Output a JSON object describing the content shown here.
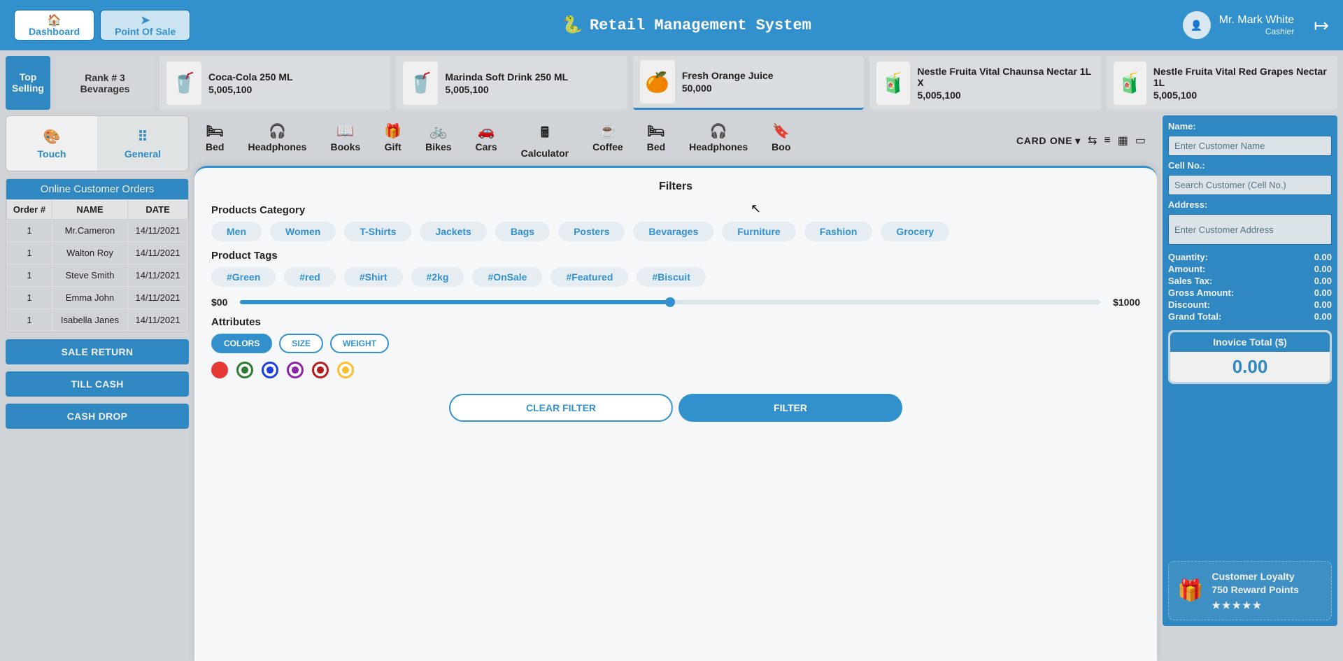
{
  "header": {
    "nav": [
      {
        "label": "Dashboard",
        "icon": "🏠"
      },
      {
        "label": "Point Of Sale",
        "icon": "➤"
      }
    ],
    "title": "Retail Management System",
    "title_icon": "🐍",
    "user": {
      "name": "Mr. Mark White",
      "role": "Cashier",
      "avatar": "👤",
      "logout_icon": "↦"
    }
  },
  "topselling": {
    "label": "Top Selling",
    "rank": {
      "line1": "Rank # 3",
      "line2": "Bevarages"
    },
    "products": [
      {
        "name": "Coca-Cola 250 ML",
        "price": "5,005,100",
        "icon": "🥤",
        "color": "#c62828",
        "hl": false
      },
      {
        "name": "Marinda Soft Drink 250 ML",
        "price": "5,005,100",
        "icon": "🥤",
        "color": "#f57c00",
        "hl": false
      },
      {
        "name": "Fresh Orange Juice",
        "price": "50,000",
        "icon": "🍊",
        "color": "#fb8c00",
        "hl": true
      },
      {
        "name": "Nestle Fruita Vital Chaunsa Nectar 1L X",
        "price": "5,005,100",
        "icon": "🧃",
        "color": "#ffa000",
        "hl": false
      },
      {
        "name": "Nestle Fruita Vital Red Grapes Nectar 1L",
        "price": "5,005,100",
        "icon": "🧃",
        "color": "#c62828",
        "hl": false
      }
    ]
  },
  "left": {
    "modes": [
      {
        "label": "Touch",
        "icon": "🎨",
        "sel": true
      },
      {
        "label": "General",
        "icon": "⠿",
        "sel": false
      }
    ],
    "orders_title": "Online Customer Orders",
    "orders_cols": [
      "Order #",
      "NAME",
      "DATE"
    ],
    "orders": [
      {
        "num": "1",
        "name": "Mr.Cameron",
        "date": "14/11/2021"
      },
      {
        "num": "1",
        "name": "Walton Roy",
        "date": "14/11/2021"
      },
      {
        "num": "1",
        "name": "Steve Smith",
        "date": "14/11/2021"
      },
      {
        "num": "1",
        "name": "Emma John",
        "date": "14/11/2021"
      },
      {
        "num": "1",
        "name": "Isabella Janes",
        "date": "14/11/2021"
      }
    ],
    "buttons": [
      "SALE RETURN",
      "TILL CASH",
      "CASH DROP"
    ]
  },
  "center": {
    "categories": [
      {
        "label": "Bed",
        "icon": "🛏"
      },
      {
        "label": "Headphones",
        "icon": "🎧"
      },
      {
        "label": "Books",
        "icon": "📖"
      },
      {
        "label": "Gift",
        "icon": "🎁"
      },
      {
        "label": "Bikes",
        "icon": "🚲"
      },
      {
        "label": "Cars",
        "icon": "🚗"
      },
      {
        "label": "Calculator",
        "icon": "🖩"
      },
      {
        "label": "Coffee",
        "icon": "☕"
      },
      {
        "label": "Bed",
        "icon": "🛏"
      },
      {
        "label": "Headphones",
        "icon": "🎧"
      },
      {
        "label": "Boo",
        "icon": "🔖"
      }
    ],
    "card_label": "CARD ONE",
    "tools": [
      "⇆",
      "≡",
      "▦",
      "▭"
    ]
  },
  "modal": {
    "title": "Filters",
    "section_category": "Products Category",
    "categories": [
      "Men",
      "Women",
      "T-Shirts",
      "Jackets",
      "Bags",
      "Posters",
      "Bevarages",
      "Furniture",
      "Fashion",
      "Grocery"
    ],
    "section_tags": "Product Tags",
    "tags": [
      "#Green",
      "#red",
      "#Shirt",
      "#2kg",
      "#OnSale",
      "#Featured",
      "#Biscuit"
    ],
    "slider": {
      "min": "$00",
      "max": "$1000"
    },
    "section_attr": "Attributes",
    "attr_tabs": [
      {
        "label": "COLORS",
        "sel": true
      },
      {
        "label": "SIZE",
        "sel": false
      },
      {
        "label": "WEIGHT",
        "sel": false
      }
    ],
    "colors": [
      {
        "hex": "#e53935",
        "solid": true
      },
      {
        "hex": "#2e7d32",
        "solid": false
      },
      {
        "hex": "#1e3fe6",
        "solid": false
      },
      {
        "hex": "#8e24aa",
        "solid": false
      },
      {
        "hex": "#b71c1c",
        "solid": false
      },
      {
        "hex": "#fbc02d",
        "solid": false
      }
    ],
    "clear": "CLEAR FILTER",
    "apply": "FILTER"
  },
  "right": {
    "fields": [
      {
        "label": "Name:",
        "ph": "Enter Customer Name"
      },
      {
        "label": "Cell No.:",
        "ph": "Search Customer (Cell No.)"
      },
      {
        "label": "Address:",
        "ph": "Enter Customer Address"
      }
    ],
    "totals": [
      {
        "label": "Quantity:",
        "val": "0.00"
      },
      {
        "label": "Amount:",
        "val": "0.00"
      },
      {
        "label": "Sales Tax:",
        "val": "0.00"
      },
      {
        "label": "Gross Amount:",
        "val": "0.00"
      },
      {
        "label": "Discount:",
        "val": "0.00"
      },
      {
        "label": "Grand Total:",
        "val": "0.00"
      }
    ],
    "invoice_title": "Inovice Total ($)",
    "invoice_val": "0.00",
    "loyalty": {
      "title": "Customer Loyalty",
      "points": "750 Reward Points",
      "stars": "★★★★★",
      "icon": "🎁"
    }
  }
}
